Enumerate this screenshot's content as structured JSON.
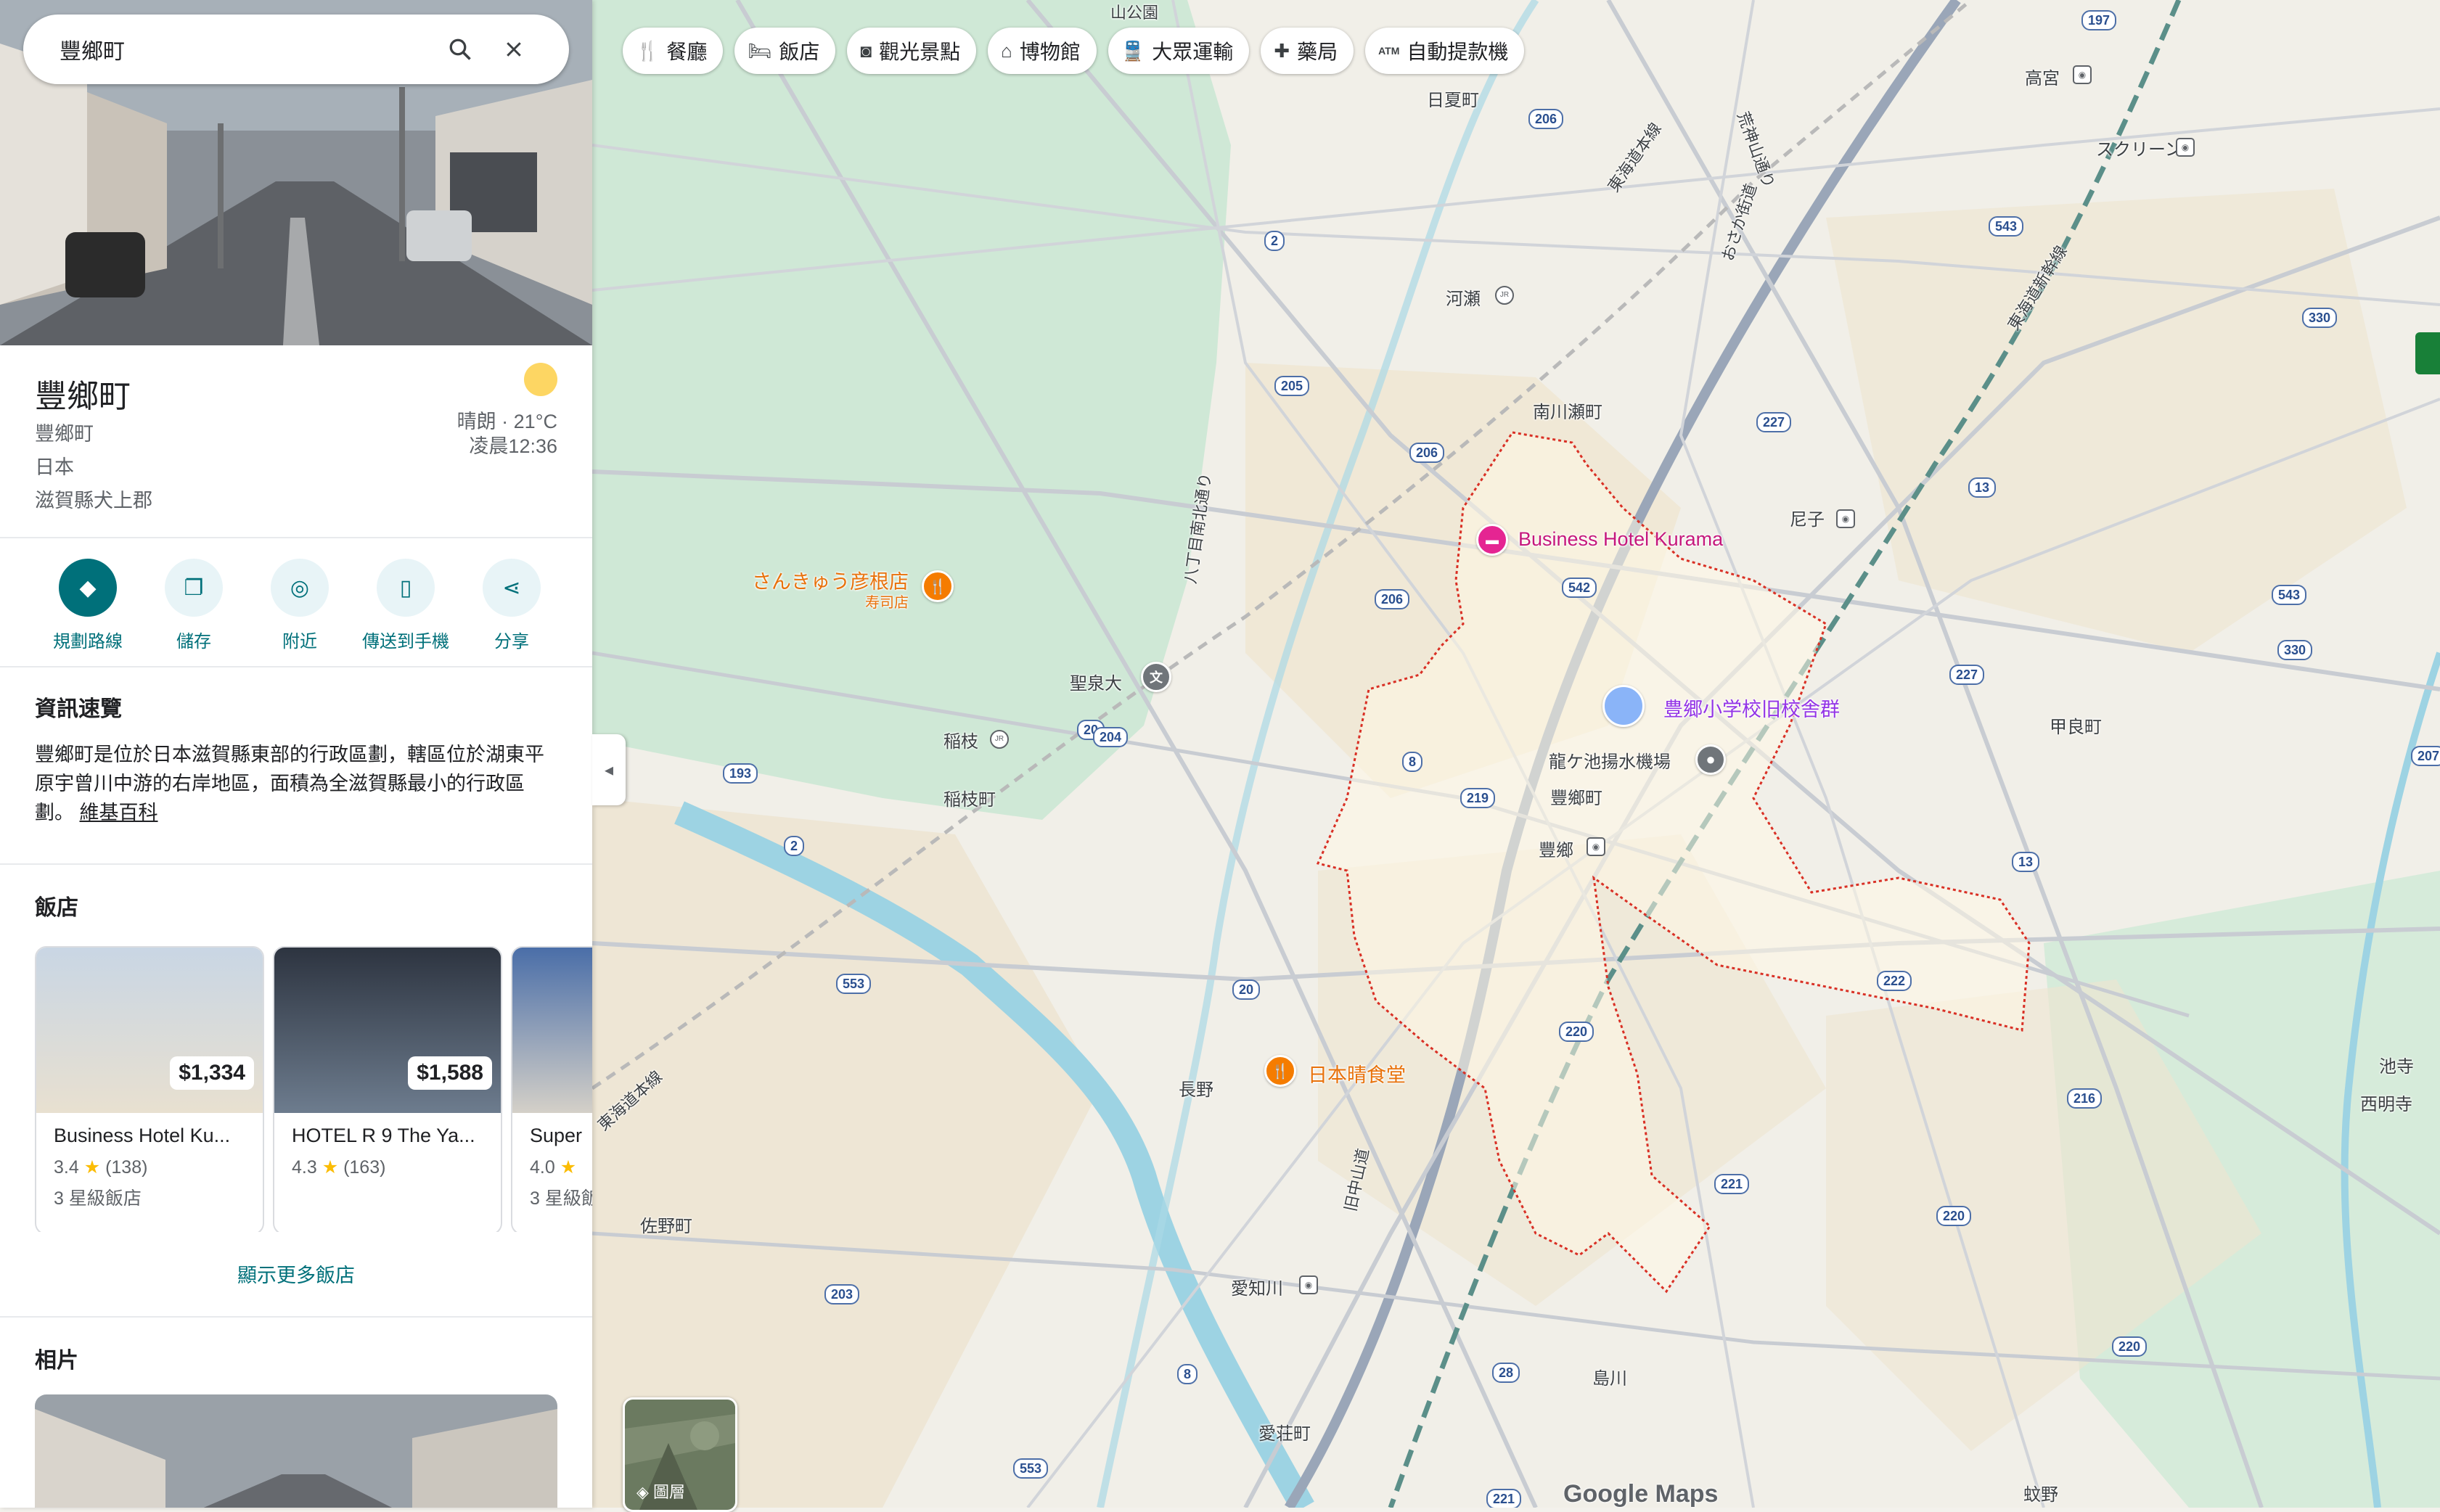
{
  "search": {
    "value": "豐鄉町"
  },
  "place": {
    "title": "豐鄉町",
    "lines": [
      "豐鄉町",
      "日本",
      "滋賀縣犬上郡"
    ],
    "weather": {
      "condition": "晴朗 · 21°C",
      "time": "凌晨12:36"
    }
  },
  "actions": [
    {
      "label": "規劃路線",
      "icon": "directions-icon"
    },
    {
      "label": "儲存",
      "icon": "bookmark-icon"
    },
    {
      "label": "附近",
      "icon": "nearby-icon"
    },
    {
      "label": "傳送到手機",
      "icon": "send-to-phone-icon"
    },
    {
      "label": "分享",
      "icon": "share-icon"
    }
  ],
  "overview": {
    "title": "資訊速覽",
    "text": "豐鄉町是位於日本滋賀縣東部的行政區劃，轄區位於湖東平原宇曾川中游的右岸地區，面積為全滋賀縣最小的行政區劃。",
    "link": "維基百科"
  },
  "hotels": {
    "title": "飯店",
    "items": [
      {
        "price": "$1,334",
        "name": "Business Hotel Ku...",
        "rating": "3.4",
        "reviews": "(138)",
        "class": "3 星級飯店"
      },
      {
        "price": "$1,588",
        "name": "HOTEL R 9 The Ya...",
        "rating": "4.3",
        "reviews": "(163)",
        "class": ""
      },
      {
        "price": "",
        "name": "Super",
        "rating": "4.0",
        "reviews": "",
        "class": "3 星級飯"
      }
    ],
    "more": "顯示更多飯店"
  },
  "photos": {
    "title": "相片"
  },
  "chips": [
    {
      "label": "餐廳",
      "icon": "fork-knife-icon"
    },
    {
      "label": "飯店",
      "icon": "bed-icon"
    },
    {
      "label": "觀光景點",
      "icon": "camera-icon"
    },
    {
      "label": "博物館",
      "icon": "museum-icon"
    },
    {
      "label": "大眾運輸",
      "icon": "train-icon"
    },
    {
      "label": "藥局",
      "icon": "pharmacy-icon"
    },
    {
      "label": "自動提款機",
      "icon": "atm-icon"
    }
  ],
  "map": {
    "layers_label": "圖層",
    "logo": "Google Maps",
    "places": {
      "hidaka": "日夏町",
      "kawase": "河瀬",
      "minamikawase": "南川瀬町",
      "amago": "尼子",
      "koura": "甲良町",
      "inae": "稲枝",
      "inaecho": "稲枝町",
      "seisen": "聖泉大",
      "toyosato_town": "豐鄉町",
      "toyosato_st": "豐鄉",
      "nagano": "長野",
      "echigawa": "愛知川",
      "aisho": "愛荘町",
      "shimagawa": "島川",
      "sanocho": "佐野町",
      "takamiya": "高宮",
      "ikedera": "池寺",
      "saimyoji": "西明寺",
      "monya": "蚊野",
      "screen": "スクリーン",
      "ryugaike": "龍ケ池揚水機場",
      "yamakoen": "山公園",
      "tokaido_line1": "東海道本線",
      "tokaido_line2": "東海道本線",
      "shinkansen": "東海道新幹線",
      "arajinzan": "荒神山通り",
      "osaka_kaido": "おさか街道",
      "hatchome": "八丁目南北通り",
      "nakasendo": "旧中山道"
    },
    "pois": {
      "hotel": "Business Hotel Kurama",
      "school": "豊郷小学校旧校舎群",
      "sushi": "さんきゅう彦根店",
      "sushi_sub": "寿司店",
      "diner": "日本晴食堂"
    },
    "route_numbers": [
      "197",
      "206",
      "2",
      "205",
      "227",
      "206",
      "13",
      "543",
      "330",
      "206",
      "542",
      "20",
      "193",
      "204",
      "8",
      "219",
      "2",
      "553",
      "20",
      "220",
      "222",
      "216",
      "221",
      "220",
      "220",
      "203",
      "8",
      "28",
      "553",
      "221",
      "207",
      "13",
      "543",
      "330",
      "227"
    ]
  }
}
